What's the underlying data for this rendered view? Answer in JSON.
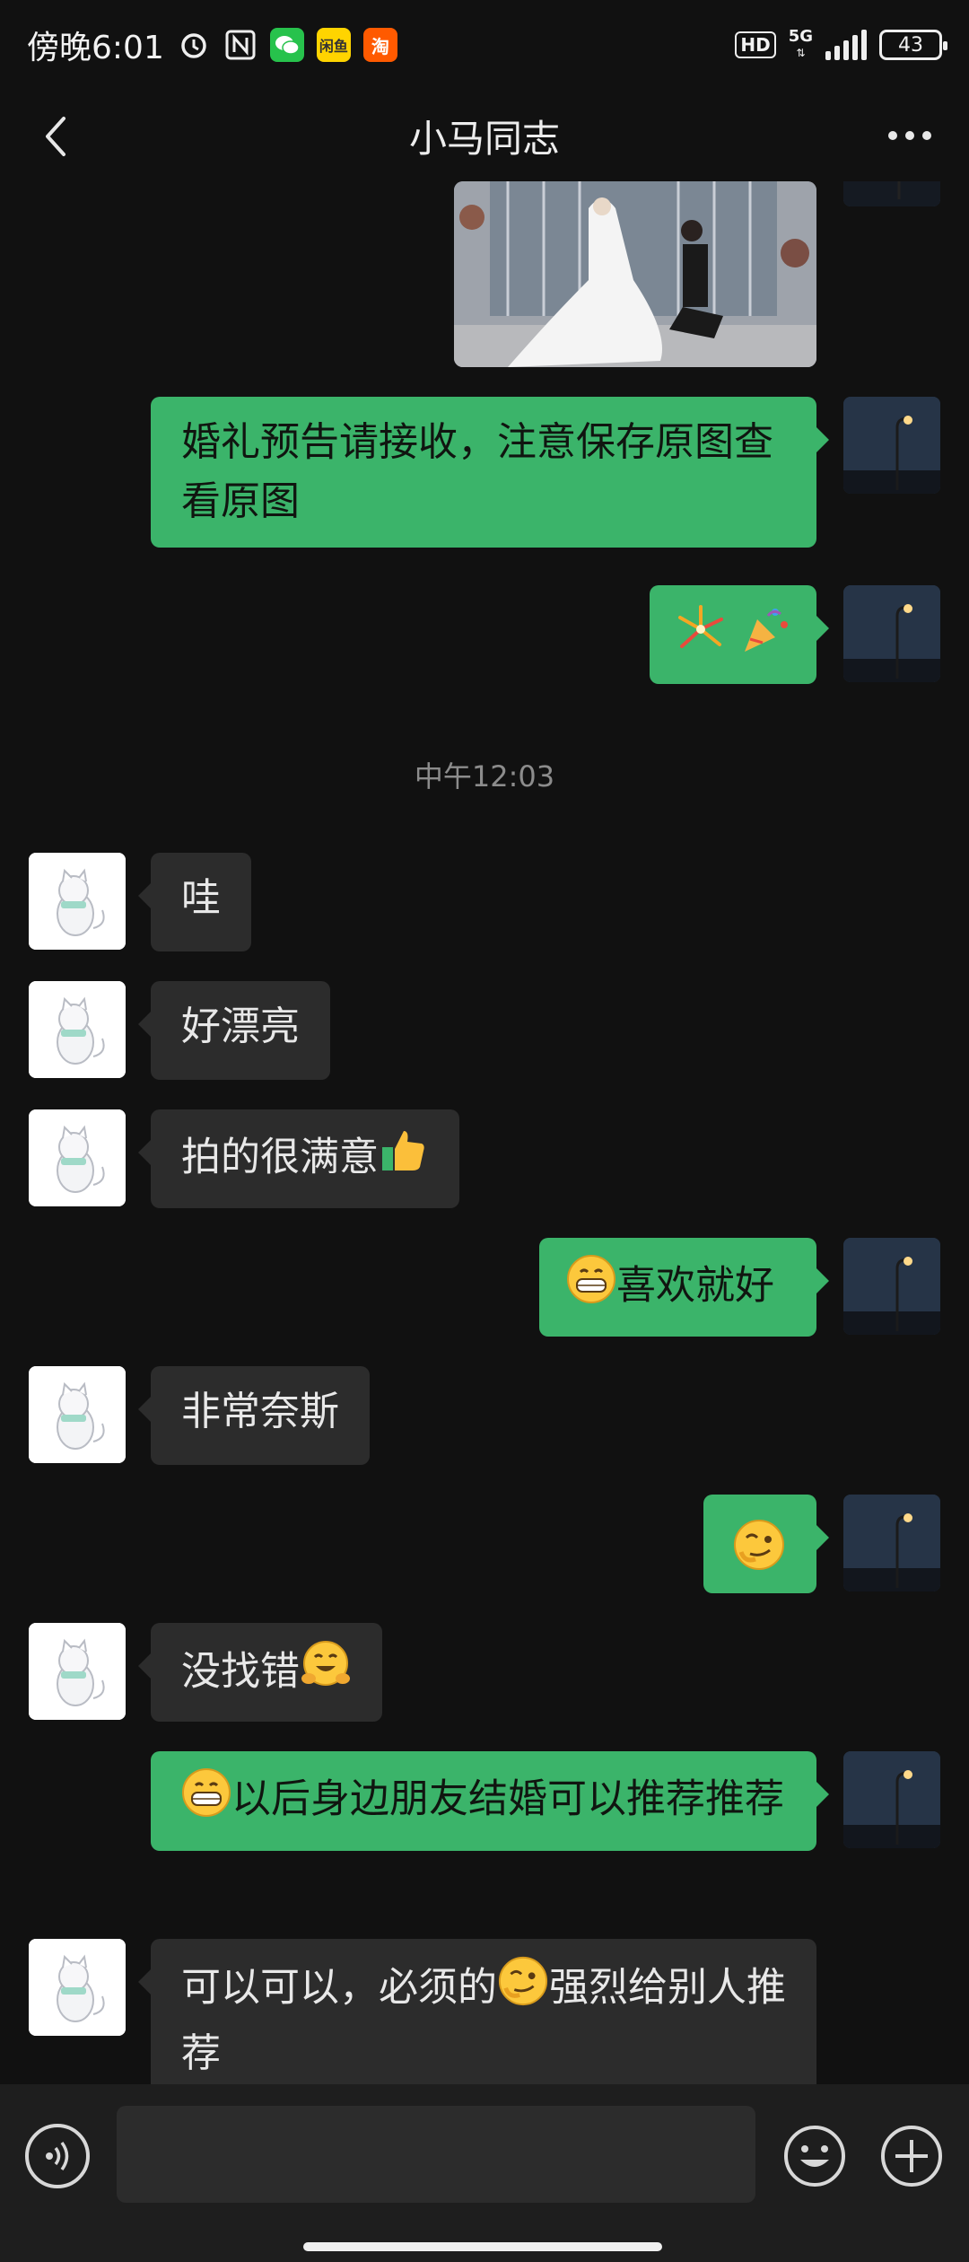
{
  "status_bar": {
    "time": "傍晚6:01",
    "hd": "HD",
    "network": "5G",
    "battery": "43",
    "app_icons": [
      "alarm-icon",
      "nfc-icon",
      "wechat-icon",
      "xianyu-icon",
      "taobao-icon"
    ]
  },
  "header": {
    "title": "小马同志"
  },
  "chat": {
    "timestamp": "中午12:03",
    "messages": [
      {
        "side": "out",
        "type": "image"
      },
      {
        "side": "out",
        "text": "婚礼预告请接收，注意保存原图查看原图"
      },
      {
        "side": "out",
        "text": "",
        "emojis": [
          "fireworks-emoji",
          "party-popper-emoji"
        ]
      },
      {
        "side": "in",
        "text": "哇"
      },
      {
        "side": "in",
        "text": "好漂亮"
      },
      {
        "side": "in",
        "text": "拍的很满意",
        "emojis": [
          "thumbs-up-emoji"
        ]
      },
      {
        "side": "out",
        "text": "喜欢就好",
        "emojis": [
          "grin-emoji"
        ]
      },
      {
        "side": "in",
        "text": "非常奈斯"
      },
      {
        "side": "out",
        "text": "",
        "emojis": [
          "smirk-emoji"
        ]
      },
      {
        "side": "in",
        "text": "没找错",
        "emojis": [
          "hugging-emoji"
        ]
      },
      {
        "side": "out",
        "text": "以后身边朋友结婚可以推荐推荐",
        "emojis": [
          "grin-emoji"
        ]
      },
      {
        "side": "in",
        "text_a": "可以可以，必须的",
        "text_b": "强烈给别人推荐",
        "emojis": [
          "smirk-emoji"
        ]
      }
    ]
  },
  "input_bar": {
    "placeholder": ""
  },
  "colors": {
    "background": "#111111",
    "outgoing_bubble": "#3bb46a",
    "incoming_bubble": "#2c2c2c",
    "bottom_bar": "#1e1e1e"
  }
}
